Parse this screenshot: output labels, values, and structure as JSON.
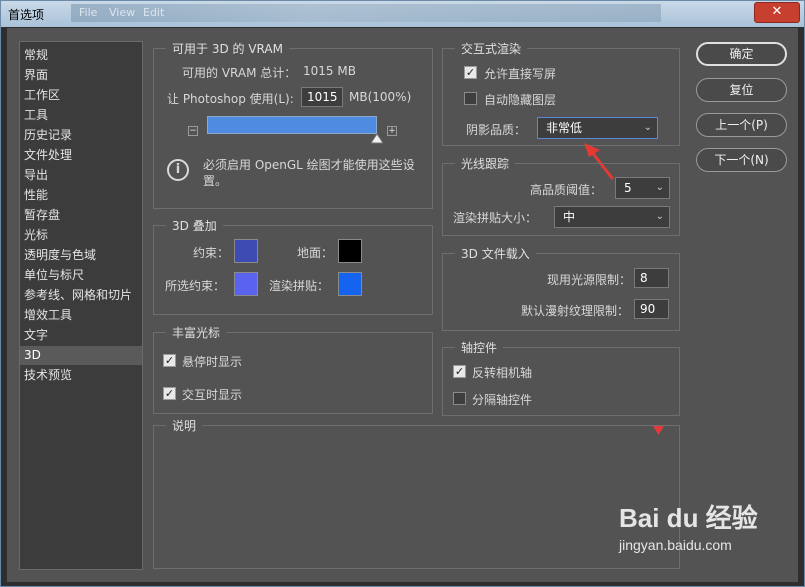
{
  "window": {
    "title": "首选项",
    "close_glyph": "✕",
    "ghost_menu": [
      "File",
      "View",
      "Edit"
    ]
  },
  "nav": {
    "items": [
      "常规",
      "界面",
      "工作区",
      "工具",
      "历史记录",
      "文件处理",
      "导出",
      "性能",
      "暂存盘",
      "光标",
      "透明度与色域",
      "单位与标尺",
      "参考线、网格和切片",
      "增效工具",
      "文字",
      "3D",
      "技术预览"
    ],
    "selected": "3D"
  },
  "vram": {
    "title": "可用于 3D 的 VRAM",
    "total_label": "可用的 VRAM 总计：",
    "total_value": "1015 MB",
    "use_label": "让 Photoshop 使用(L):",
    "use_value": "1015",
    "use_unit": "MB(100%)",
    "slider_value_percent": 100,
    "minus_glyph": "−",
    "plus_glyph": "+",
    "note": "必须启用 OpenGL 绘图才能使用这些设置。",
    "info_glyph": "i"
  },
  "overlay": {
    "title": "3D 叠加",
    "constraint_label": "约束：",
    "ground_label": "地面：",
    "selected_constraint_label": "所选约束：",
    "render_tile_label": "渲染拼贴：",
    "colors": {
      "constraint": "#3d4bb3",
      "ground": "#000000",
      "selected_constraint": "#5a63f0",
      "render_tile": "#1464f0"
    }
  },
  "rich_cursor": {
    "title": "丰富光标",
    "show_on_hover": "悬停时显示",
    "show_on_interact": "交互时显示",
    "check_glyph": "✓"
  },
  "description": {
    "title": "说明"
  },
  "interactive_render": {
    "title": "交互式渲染",
    "allow_direct_write": "允许直接写屏",
    "auto_hide_layers": "自动隐藏图层",
    "shadow_quality_label": "阴影品质：",
    "shadow_quality_value": "非常低",
    "caret": "⌄"
  },
  "ray_tracing": {
    "title": "光线跟踪",
    "hq_threshold_label": "高品质阈值：",
    "hq_threshold_value": "5",
    "tile_size_label": "渲染拼贴大小：",
    "tile_size_value": "中"
  },
  "file_load": {
    "title": "3D 文件载入",
    "light_limit_label": "现用光源限制：",
    "light_limit_value": "8",
    "texture_limit_label": "默认漫射纹理限制：",
    "texture_limit_value": "90"
  },
  "axis": {
    "title": "轴控件",
    "invert_camera": "反转相机轴",
    "separate_axis": "分隔轴控件"
  },
  "buttons": {
    "ok": "确定",
    "reset": "复位",
    "prev": "上一个(P)",
    "next": "下一个(N)"
  },
  "watermark": {
    "brand": "Bai du 经验",
    "url": "jingyan.baidu.com"
  }
}
